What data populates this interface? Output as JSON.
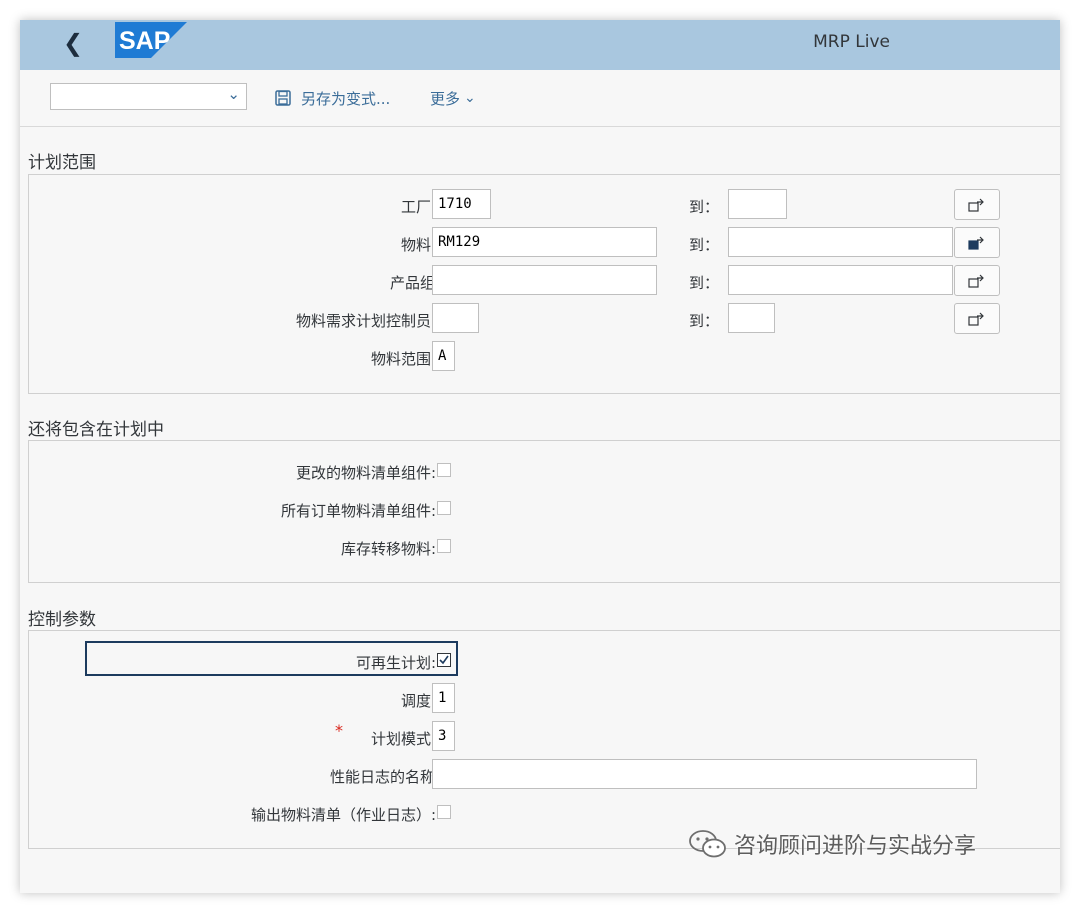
{
  "shell": {
    "app_title": "MRP Live",
    "logo_text": "SAP"
  },
  "toolbar": {
    "variant_value": "",
    "save_variant_label": "另存为变式...",
    "more_label": "更多"
  },
  "planning_scope": {
    "title": "计划范围",
    "to_label": "到：",
    "rows": [
      {
        "label": "工厂:",
        "from": "1710",
        "to": ""
      },
      {
        "label": "物料:",
        "from": "RM129",
        "to": ""
      },
      {
        "label": "产品组：",
        "from": "",
        "to": ""
      },
      {
        "label": "物料需求计划控制员:",
        "from": "",
        "to": ""
      }
    ],
    "material_scope": {
      "label": "物料范围:",
      "value": "A"
    }
  },
  "also_include": {
    "title": "还将包含在计划中",
    "items": [
      {
        "label": "更改的物料清单组件:",
        "checked": false
      },
      {
        "label": "所有订单物料清单组件:",
        "checked": false
      },
      {
        "label": "库存转移物料:",
        "checked": false
      }
    ]
  },
  "control_params": {
    "title": "控制参数",
    "regenerative": {
      "label": "可再生计划:",
      "checked": true
    },
    "scheduling": {
      "label": "调度:",
      "value": "1"
    },
    "planning_mode": {
      "label": "计划模式:",
      "value": "3",
      "required_mark": "*"
    },
    "perf_log_name": {
      "label": "性能日志的名称：",
      "value": ""
    },
    "output_bom": {
      "label": "输出物料清单（作业日志）:",
      "checked": false
    }
  },
  "watermark": {
    "text": "咨询顾问进阶与实战分享"
  },
  "icons": {
    "back": "chevron-left-icon",
    "save": "floppy-disk-icon",
    "range": "multiple-selection-icon",
    "range_filled": "multiple-selection-active-icon"
  },
  "colors": {
    "shell": "#a9c7df",
    "link": "#3b6d99",
    "focus": "#1d3b5e",
    "required": "#d9261c"
  }
}
